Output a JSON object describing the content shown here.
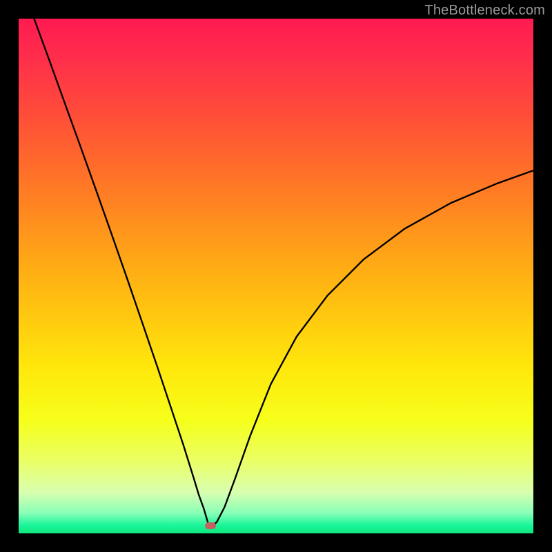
{
  "watermark": "TheBottleneck.com",
  "marker": {
    "x_frac": 0.373,
    "y_frac": 0.985,
    "color": "#c4625f"
  },
  "chart_data": {
    "type": "line",
    "title": "",
    "xlabel": "",
    "ylabel": "",
    "xlim": [
      0,
      1
    ],
    "ylim": [
      0,
      1
    ],
    "notes": "V-shaped bottleneck curve over a vertical green-to-red gradient; y is fraction of plot height from bottom; x is fraction of plot width from left. Minimum at x≈0.373.",
    "series": [
      {
        "name": "bottleneck-curve",
        "x": [
          0.03,
          0.06,
          0.09,
          0.12,
          0.15,
          0.18,
          0.21,
          0.24,
          0.27,
          0.3,
          0.32,
          0.34,
          0.35,
          0.36,
          0.368,
          0.373,
          0.385,
          0.4,
          0.42,
          0.45,
          0.49,
          0.54,
          0.6,
          0.67,
          0.75,
          0.84,
          0.93,
          1.0
        ],
        "y": [
          1.0,
          0.918,
          0.835,
          0.752,
          0.668,
          0.583,
          0.497,
          0.41,
          0.322,
          0.232,
          0.172,
          0.108,
          0.075,
          0.047,
          0.02,
          0.012,
          0.022,
          0.051,
          0.105,
          0.19,
          0.29,
          0.382,
          0.462,
          0.532,
          0.592,
          0.642,
          0.68,
          0.705
        ]
      }
    ],
    "marker_point": {
      "x": 0.373,
      "y": 0.015
    },
    "gradient_stops": [
      {
        "pos": 0.0,
        "color": "#ff1a52"
      },
      {
        "pos": 0.5,
        "color": "#ffc000"
      },
      {
        "pos": 0.8,
        "color": "#f5ff30"
      },
      {
        "pos": 0.96,
        "color": "#8affb8"
      },
      {
        "pos": 1.0,
        "color": "#10e87d"
      }
    ]
  }
}
